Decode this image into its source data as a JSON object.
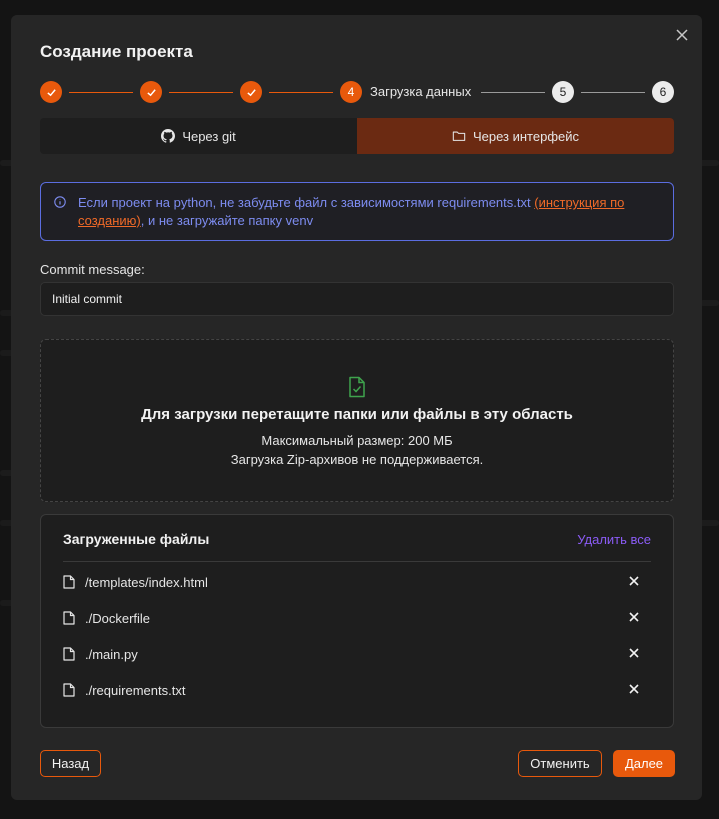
{
  "modal": {
    "title": "Создание проекта",
    "close_icon": "close-icon"
  },
  "stepper": {
    "steps": [
      {
        "state": "done"
      },
      {
        "state": "done"
      },
      {
        "state": "done"
      },
      {
        "state": "active",
        "number": "4",
        "label": "Загрузка данных"
      },
      {
        "state": "todo",
        "number": "5"
      },
      {
        "state": "todo",
        "number": "6"
      }
    ]
  },
  "tabs": {
    "git": {
      "label": "Через git",
      "icon": "github-icon"
    },
    "ui": {
      "label": "Через интерфейс",
      "icon": "folder-icon",
      "selected": true
    }
  },
  "info": {
    "text_before": "Если проект на python, не забудьте файл с зависимостями requirements.txt ",
    "link": "(инструкция по созданию)",
    "text_after": ", и не загружайте папку venv"
  },
  "commit": {
    "label": "Commit message:",
    "value": "Initial commit"
  },
  "dropzone": {
    "title": "Для загрузки перетащите папки или файлы в эту область",
    "max_size": "Максимальный размер: 200 МБ",
    "zip_note": "Загрузка Zip-архивов не поддерживается."
  },
  "files": {
    "title": "Загруженные файлы",
    "delete_all": "Удалить все",
    "items": [
      {
        "name": "/templates/index.html"
      },
      {
        "name": "./Dockerfile"
      },
      {
        "name": "./main.py"
      },
      {
        "name": "./requirements.txt"
      }
    ]
  },
  "footer": {
    "back": "Назад",
    "cancel": "Отменить",
    "next": "Далее"
  },
  "colors": {
    "accent": "#e8590c",
    "info_border": "#5b6de0",
    "delete_all": "#8b5cf6"
  }
}
